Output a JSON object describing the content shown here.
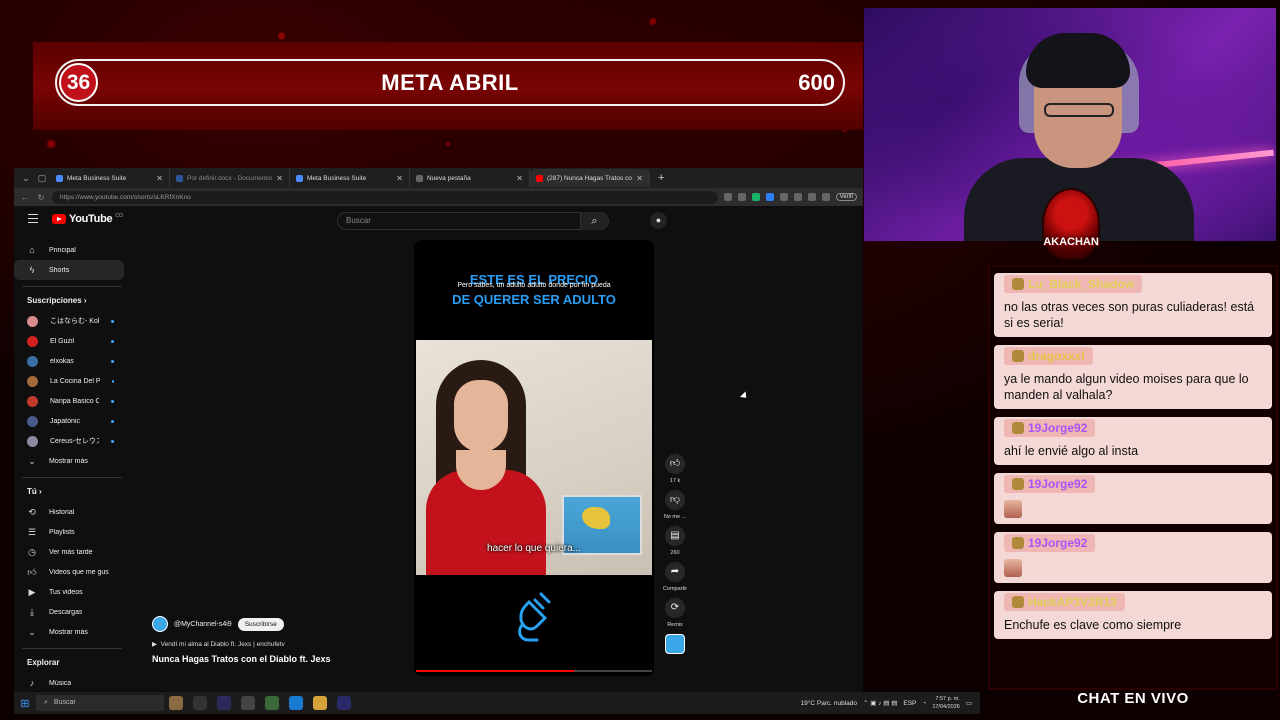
{
  "goal": {
    "current": "36",
    "title": "META ABRIL",
    "target": "600",
    "progress_fraction": 0.06
  },
  "browser": {
    "tabs": [
      {
        "label": "Meta Business Suite",
        "icon": "meta-icon"
      },
      {
        "label": "Por definir.docx - Documentos de",
        "icon": "doc-icon"
      },
      {
        "label": "Meta Business Suite",
        "icon": "meta-icon"
      },
      {
        "label": "Nueva pestaña",
        "icon": "new-tab-icon"
      },
      {
        "label": "(287) Nunca Hagas Tratos con",
        "icon": "youtube-icon"
      }
    ],
    "url": "https://www.youtube.com/shorts/sLKRfXnKno",
    "verified_label": "Verifi"
  },
  "youtube": {
    "logo_text": "YouTube",
    "logo_sup": "CO",
    "search_placeholder": "Buscar",
    "nav": [
      {
        "label": "Principal",
        "icon": "home-icon"
      },
      {
        "label": "Shorts",
        "icon": "shorts-icon"
      }
    ],
    "subscriptions_header": "Suscripciones",
    "subscriptions": [
      {
        "label": "こはならむ- Koh...",
        "color": "#d98a8a"
      },
      {
        "label": "El Guzil",
        "color": "#d02020"
      },
      {
        "label": "elxokas",
        "color": "#3a6ea5"
      },
      {
        "label": "La Cocina Del Pir...",
        "color": "#a46b3a"
      },
      {
        "label": "Nanpa Basico O...",
        "color": "#c0392b"
      },
      {
        "label": "Japatonic",
        "color": "#4a5a8a"
      },
      {
        "label": "Cereus-セレウス-",
        "color": "#8a8aa0"
      }
    ],
    "show_more": "Mostrar más",
    "you_header": "Tú",
    "you_items": [
      {
        "label": "Historial",
        "icon": "history-icon"
      },
      {
        "label": "Playlists",
        "icon": "playlist-icon"
      },
      {
        "label": "Ver más tarde",
        "icon": "clock-icon"
      },
      {
        "label": "Videos que me gus...",
        "icon": "thumbs-up-icon"
      },
      {
        "label": "Tus videos",
        "icon": "video-icon"
      },
      {
        "label": "Descargas",
        "icon": "download-icon"
      },
      {
        "label": "Mostrar más",
        "icon": "chevron-down-icon"
      }
    ],
    "explore_header": "Explorar",
    "explore_item": "Música",
    "short": {
      "overlay_title_line1": "ESTE ES EL PRECIO",
      "overlay_title_line2": "DE QUERER SER ADULTO",
      "overlay_caption": "Pero sabes, un adulto adulto donde por fin pueda",
      "subtitle": "hacer lo que quiera...",
      "progress_fraction": 0.67,
      "likes": "17 k",
      "dislike_label": "No me ...",
      "comments": "260",
      "share_label": "Compartir",
      "remix_label": "Remix"
    },
    "channel_handle": "@MyChannel-s4i9",
    "subscribe_label": "Suscribirse",
    "sound_label": "Vendí mi alma al Diablo ft. Jexs | enchufetv",
    "video_title": "Nunca Hagas Tratos con el Diablo ft. Jexs"
  },
  "taskbar": {
    "search_placeholder": "Buscar",
    "weather": "19°C  Parc. nublado",
    "language": "ESP",
    "time": "7:57 p. m.",
    "date": "17/04/2026"
  },
  "chat": {
    "messages": [
      {
        "user": "Lu_Black_Shadow",
        "user_color": "#e3d25a",
        "text": "no las otras veces son puras culiaderas! está si es seria!"
      },
      {
        "user": "dragoxxxl",
        "user_color": "#e3c24a",
        "text": "ya le mando algun video moises para que lo manden al valhala?"
      },
      {
        "user": "19Jorge92",
        "user_color": "#a855f7",
        "text": "ahí le envié algo al insta"
      },
      {
        "user": "19Jorge92",
        "user_color": "#a855f7",
        "text": ""
      },
      {
        "user": "19Jorge92",
        "user_color": "#a855f7",
        "text": ""
      },
      {
        "user": "HackAP3V2R13",
        "user_color": "#e0cf55",
        "text": "Enchufe es clave como siempre"
      }
    ],
    "footer": "CHAT EN VIVO",
    "logo_text": "AKACHAN"
  }
}
